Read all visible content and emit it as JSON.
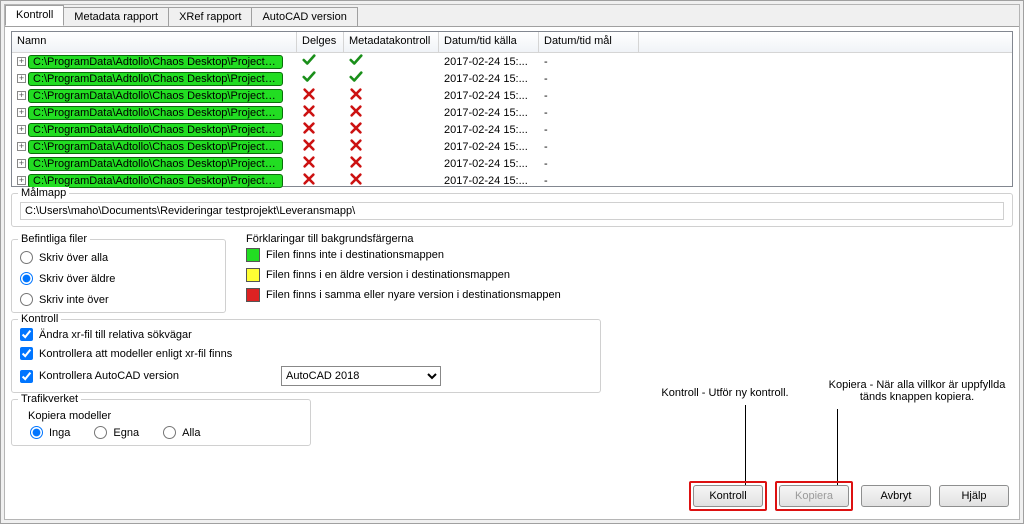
{
  "tabs": [
    "Kontroll",
    "Metadata rapport",
    "XRef rapport",
    "AutoCAD version"
  ],
  "columns": [
    "Namn",
    "Delges",
    "Metadatakontroll",
    "Datum/tid källa",
    "Datum/tid mål"
  ],
  "rows": [
    {
      "path": "C:\\ProgramData\\Adtollo\\Chaos Desktop\\Project\\Te...",
      "delges": "ok",
      "meta": "ok",
      "src": "2017-02-24 15:...",
      "dst": "-"
    },
    {
      "path": "C:\\ProgramData\\Adtollo\\Chaos Desktop\\Project\\Te...",
      "delges": "ok",
      "meta": "ok",
      "src": "2017-02-24 15:...",
      "dst": "-"
    },
    {
      "path": "C:\\ProgramData\\Adtollo\\Chaos Desktop\\Project\\Te...",
      "delges": "x",
      "meta": "x",
      "src": "2017-02-24 15:...",
      "dst": "-"
    },
    {
      "path": "C:\\ProgramData\\Adtollo\\Chaos Desktop\\Project\\Te...",
      "delges": "x",
      "meta": "x",
      "src": "2017-02-24 15:...",
      "dst": "-"
    },
    {
      "path": "C:\\ProgramData\\Adtollo\\Chaos Desktop\\Project\\Te...",
      "delges": "x",
      "meta": "x",
      "src": "2017-02-24 15:...",
      "dst": "-"
    },
    {
      "path": "C:\\ProgramData\\Adtollo\\Chaos Desktop\\Project\\Te...",
      "delges": "x",
      "meta": "x",
      "src": "2017-02-24 15:...",
      "dst": "-"
    },
    {
      "path": "C:\\ProgramData\\Adtollo\\Chaos Desktop\\Project\\Te...",
      "delges": "x",
      "meta": "x",
      "src": "2017-02-24 15:...",
      "dst": "-"
    },
    {
      "path": "C:\\ProgramData\\Adtollo\\Chaos Desktop\\Project\\Te...",
      "delges": "x",
      "meta": "x",
      "src": "2017-02-24 15:...",
      "dst": "-"
    }
  ],
  "malmapp": {
    "label": "Målmapp",
    "value": "C:\\Users\\maho\\Documents\\Revideringar testprojekt\\Leveransmapp\\"
  },
  "befintliga": {
    "label": "Befintliga filer",
    "opts": [
      "Skriv över alla",
      "Skriv över äldre",
      "Skriv inte över"
    ],
    "selected": 1
  },
  "forklaringar": {
    "label": "Förklaringar till bakgrundsfärgerna",
    "items": [
      {
        "color": "green",
        "text": "Filen finns inte i destinationsmappen"
      },
      {
        "color": "yellow",
        "text": "Filen finns i en äldre version i destinationsmappen"
      },
      {
        "color": "red",
        "text": "Filen finns i samma eller nyare version i destinationsmappen"
      }
    ]
  },
  "kontroll": {
    "label": "Kontroll",
    "checks": [
      "Ändra xr-fil till relativa sökvägar",
      "Kontrollera att modeller enligt xr-fil finns",
      "Kontrollera AutoCAD version"
    ],
    "autocad_options": [
      "AutoCAD 2018"
    ],
    "autocad_selected": "AutoCAD 2018"
  },
  "trafik": {
    "label": "Trafikverket",
    "subtitle": "Kopiera modeller",
    "opts": [
      "Inga",
      "Egna",
      "Alla"
    ],
    "selected": 0
  },
  "annotations": {
    "left": "Kontroll - Utför ny kontroll.",
    "right": "Kopiera - När alla villkor är uppfyllda tänds knappen kopiera."
  },
  "buttons": {
    "kontroll": "Kontroll",
    "kopiera": "Kopiera",
    "avbryt": "Avbryt",
    "hjalp": "Hjälp"
  }
}
